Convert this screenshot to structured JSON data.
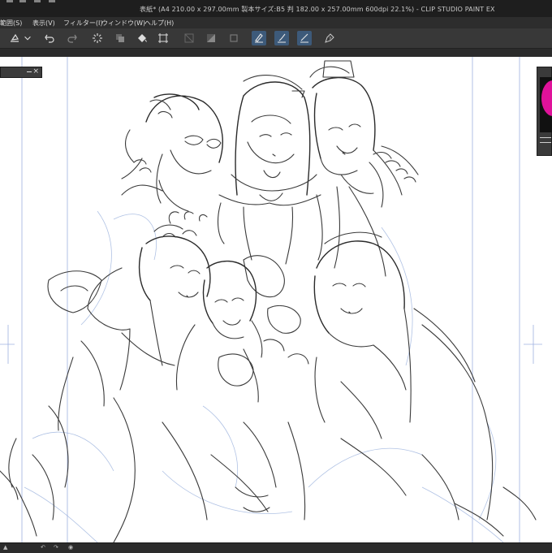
{
  "window": {
    "title": "表紙* (A4 210.00 x 297.00mm 製本サイズ:B5 判 182.00 x 257.00mm 600dpi 22.1%) - CLIP STUDIO PAINT EX"
  },
  "menu": {
    "items": [
      "範囲(S)",
      "表示(V)",
      "フィルター(I)",
      "ウィンドウ(W)",
      "ヘルプ(H)"
    ]
  },
  "toolbar": {
    "tools": [
      "paint-bucket-icon",
      "dropdown-icon",
      "undo-icon",
      "redo-icon",
      "loading-spinner-icon",
      "copy-layer-icon",
      "fill-icon",
      "transform-icon",
      "clear-icon",
      "invert-icon",
      "deselect-icon",
      "vector-pen-icon",
      "vector-brush-icon",
      "vector-ruler-icon",
      "help-icon"
    ],
    "active_color": "#3d5a7a"
  },
  "panels": {
    "left_subpanel": {
      "minimize": "_",
      "close": "×"
    },
    "navigator": {
      "preview_accent": "#e0129a"
    }
  },
  "status": {
    "zoom": "22.1%"
  }
}
